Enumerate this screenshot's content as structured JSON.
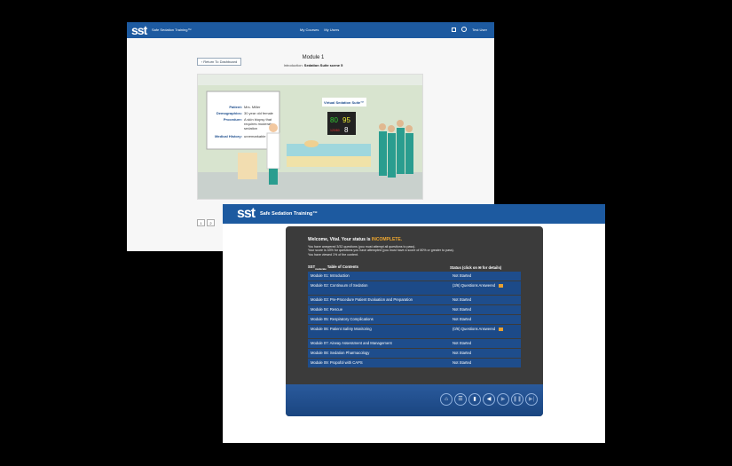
{
  "back": {
    "logo": "sst",
    "brand": "Safe Sedation Training™",
    "nav": [
      "My Courses",
      "My Users"
    ],
    "user": "Test User",
    "return_label": "‹ Return To Dashboard",
    "module_title": "Module 1",
    "module_sub_prefix": "Introduction:",
    "module_sub": "Sedation Suite scene 5",
    "scene": {
      "patient_label": "Patient:",
      "patient": "Mrs. Miller",
      "demo_label": "Demographics:",
      "demo": "30 year old female",
      "proc_label": "Procedure:",
      "proc": "A skin biopsy that requires moderate sedation",
      "hist_label": "Medical History:",
      "hist": "unremarkable",
      "suite_sign": "Virtual Sedation Suite™",
      "hr": "80",
      "spo2": "95",
      "bp": "120/80",
      "rr": "8"
    },
    "pages": [
      "1",
      "2"
    ]
  },
  "front": {
    "logo": "sst",
    "brand": "Safe Sedation Training™",
    "welcome": "Welcome, Vital. Your status is",
    "status": "INCOMPLETE.",
    "info": [
      "You have answered 3/32 questions (you must attempt all questions to pass).",
      "Your score is 33% for questions you have attempted (you must have a score of 80% or greater to pass).",
      "You have viewed 1% of the content."
    ],
    "toc_head": "SST",
    "toc_sub": "moderate",
    "toc_title": "Table of Contents",
    "status_head": "Status (click on ✉ for details)",
    "modules": [
      {
        "name": "Module 01: Introduction",
        "status": "Not Started"
      },
      {
        "name": "Module 02: Continuum of Sedation",
        "status": "(3/6) Questions Answered",
        "icon": true
      },
      {
        "name": "Module 03: Pre-Procedure Patient Evaluation and Preparation",
        "status": "Not Started"
      },
      {
        "name": "Module 04: Rescue",
        "status": "Not Started"
      },
      {
        "name": "Module 05: Respiratory Complications",
        "status": "Not Started"
      },
      {
        "name": "Module 06: Patient Safety Monitoring",
        "status": "(0/6) Questions Answered",
        "icon": true
      },
      {
        "name": "Module 07: Airway Assessment and Management",
        "status": "Not Started"
      },
      {
        "name": "Module 08: Sedation Pharmacology",
        "status": "Not Started"
      },
      {
        "name": "Module 09: Propofol with CAPS",
        "status": "Not Started"
      }
    ],
    "controls": [
      {
        "n": "home-button",
        "g": "⌂"
      },
      {
        "n": "menu-button",
        "g": "☰"
      },
      {
        "n": "glossary-button",
        "g": "▮"
      },
      {
        "n": "mute-button",
        "g": "◀"
      },
      {
        "n": "play-button",
        "g": "▶",
        "dim": true
      },
      {
        "n": "pause-button",
        "g": "❚❚",
        "dim": true
      },
      {
        "n": "next-button",
        "g": "▶|",
        "dim": true
      }
    ]
  }
}
